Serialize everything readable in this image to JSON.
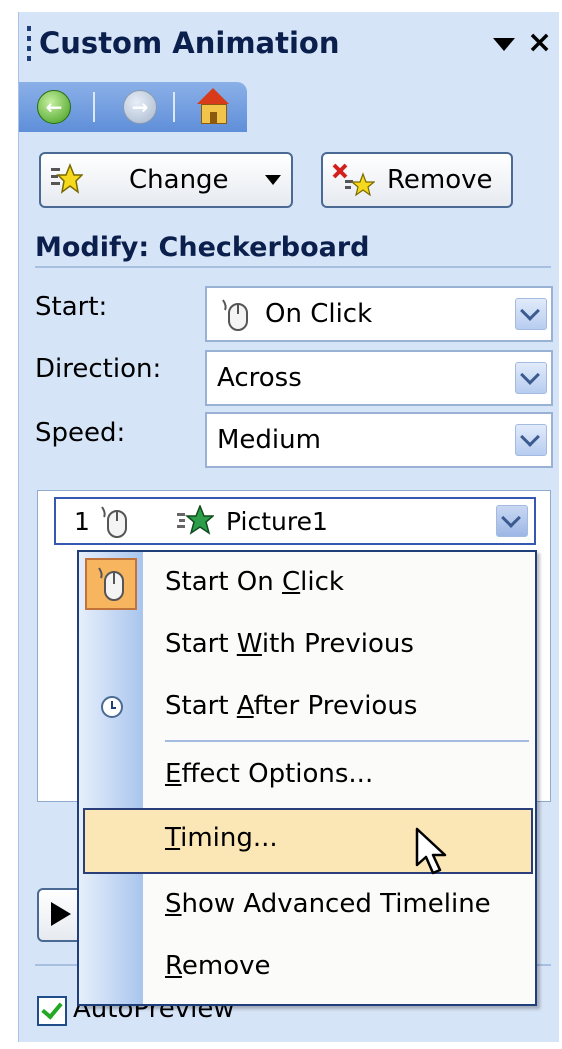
{
  "panel": {
    "title": "Custom Animation",
    "nav": [
      "back-icon",
      "forward-icon",
      "home-icon"
    ]
  },
  "buttons": {
    "change_label": "Change",
    "remove_label": "Remove"
  },
  "modify": {
    "heading": "Modify: Checkerboard",
    "start_label": "Start:",
    "start_value": "On Click",
    "direction_label": "Direction:",
    "direction_value": "Across",
    "speed_label": "Speed:",
    "speed_value": "Medium"
  },
  "animation_list": {
    "items": [
      {
        "number": "1",
        "trigger_icon": "mouse-icon",
        "effect_icon": "star-icon",
        "name": "Picture1"
      }
    ]
  },
  "context_menu": {
    "items": [
      {
        "label": "Start On Click",
        "icon": "mouse-icon",
        "underline": "C"
      },
      {
        "label": "Start With Previous",
        "icon": "",
        "underline": "W"
      },
      {
        "label": "Start After Previous",
        "icon": "clock-icon",
        "underline": "A"
      },
      {
        "label": "Effect Options...",
        "icon": "",
        "underline": "E"
      },
      {
        "label": "Timing...",
        "icon": "",
        "underline": "T",
        "highlighted": true
      },
      {
        "label": "Show Advanced Timeline",
        "icon": "",
        "underline": "S"
      },
      {
        "label": "Remove",
        "icon": "",
        "underline": "R"
      }
    ]
  },
  "footer": {
    "autopreview_label": "AutoPreview",
    "autopreview_checked": true
  },
  "colors": {
    "panel_bg": "#d6e4f7",
    "title_text": "#0b1f4d",
    "menu_highlight": "#fbe6b6",
    "menu_border": "#1f3f7a"
  }
}
